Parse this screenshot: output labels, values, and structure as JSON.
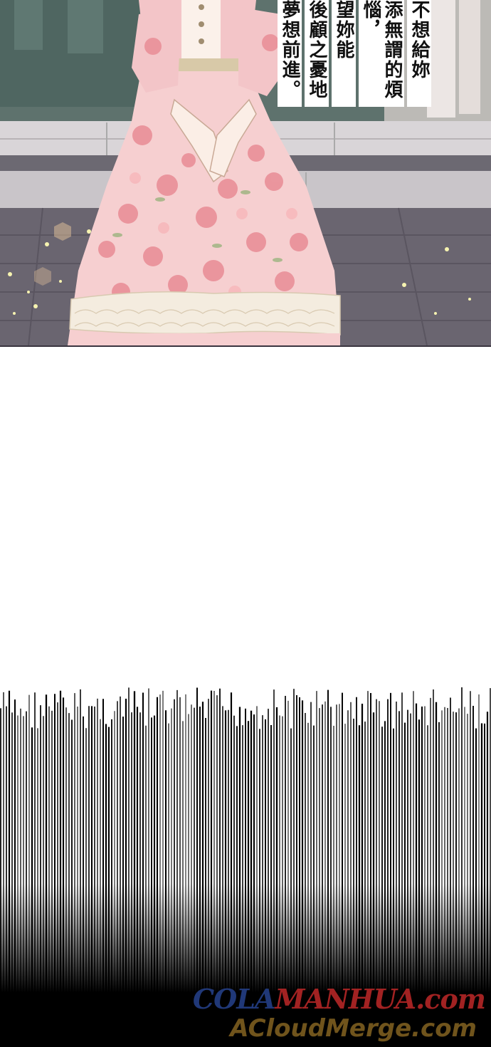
{
  "caption": {
    "columns": [
      "不想給妳",
      "添無謂的煩惱，",
      "望妳能",
      "後顧之憂地",
      "夢想前進。"
    ]
  },
  "watermark": {
    "line1_part1": "COLA",
    "line1_part2": "MANHUA.com",
    "line2": "ACloudMerge.com"
  },
  "colors": {
    "dress_pink": "#f6cfd0",
    "rose": "#e98f98",
    "background_teal": "#5b6f6a",
    "frill": "#f4ecdf"
  }
}
